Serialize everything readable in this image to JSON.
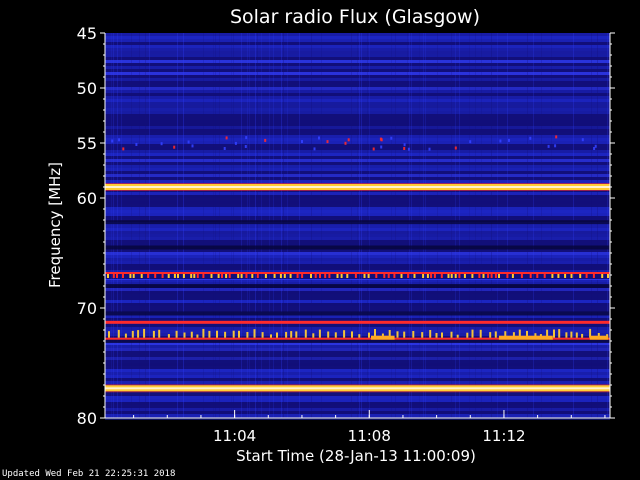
{
  "footer": "Updated Wed Feb 21 22:25:31 2018",
  "chart_data": {
    "type": "heatmap",
    "title": "Solar radio Flux (Glasgow)",
    "xlabel": "Start Time (28-Jan-13 11:00:09)",
    "ylabel": "Frequency [MHz]",
    "x_unit": "minutes after 11:00:09",
    "xlim": [
      0,
      15.0
    ],
    "x_ticks": [
      {
        "value": 3.85,
        "label": "11:04"
      },
      {
        "value": 7.85,
        "label": "11:08"
      },
      {
        "value": 11.85,
        "label": "11:12"
      }
    ],
    "ylim": [
      45,
      80
    ],
    "y_inverted": true,
    "y_ticks": [
      45,
      50,
      55,
      60,
      70,
      80
    ],
    "colors": {
      "background": "#000000",
      "noise_low": "#120f7a",
      "noise_mid": "#1f2bd4",
      "noise_high": "#3340ff",
      "hot": "#ffcc33",
      "core": "#fff2cc",
      "red": "#ff2a2a",
      "dark_band": "#06053a"
    },
    "bands": [
      {
        "freq": 59.0,
        "kind": "persistent",
        "color": "#ffcc33",
        "intensity": "high"
      },
      {
        "freq": 67.0,
        "kind": "persistent-intermittent",
        "color": "#ff2a2a",
        "intensity": "medium"
      },
      {
        "freq": 71.3,
        "kind": "persistent",
        "color": "#ff2a2a",
        "intensity": "medium"
      },
      {
        "freq": 72.7,
        "kind": "burst-series",
        "color": "#ffaa22",
        "intensity": "high"
      },
      {
        "freq": 77.3,
        "kind": "persistent",
        "color": "#ffcc33",
        "intensity": "high"
      }
    ],
    "dark_bands": [
      62.2,
      64.5,
      68.0,
      70.5,
      73.0
    ]
  }
}
